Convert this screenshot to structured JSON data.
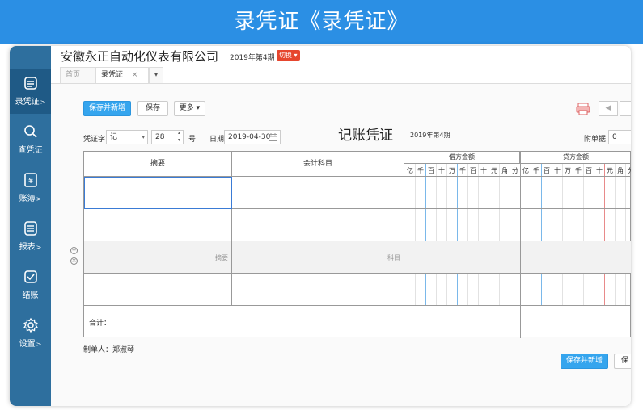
{
  "banner": {
    "title": "录凭证《录凭证》"
  },
  "sidebar": {
    "items": [
      {
        "label": "录凭证",
        "arrow": ">",
        "icon": "voucher-entry-icon",
        "active": true
      },
      {
        "label": "查凭证",
        "arrow": "",
        "icon": "search-icon",
        "active": false
      },
      {
        "label": "账簿",
        "arrow": ">",
        "icon": "ledger-yen-icon",
        "active": false
      },
      {
        "label": "报表",
        "arrow": ">",
        "icon": "report-icon",
        "active": false
      },
      {
        "label": "结账",
        "arrow": "",
        "icon": "checkout-icon",
        "active": false
      },
      {
        "label": "设置",
        "arrow": ">",
        "icon": "gear-icon",
        "active": false
      }
    ]
  },
  "header": {
    "company": "安徽永正自动化仪表有限公司",
    "period": "2019年第4期",
    "switch_label": "切换"
  },
  "tabs": [
    {
      "label": "首页",
      "active": false
    },
    {
      "label": "录凭证",
      "active": true,
      "close": "×"
    }
  ],
  "toolbar": {
    "save_new_label": "保存并新增",
    "save_label": "保存",
    "more_label": "更多"
  },
  "voucher": {
    "word_label": "凭证字",
    "word_value": "记",
    "number_value": "28",
    "number_suffix": "号",
    "date_label": "日期",
    "date_value": "2019-04-30",
    "title": "记账凭证",
    "period": "2019年第4期",
    "attachments_label": "附单据",
    "attachments_value": "0"
  },
  "table": {
    "col_summary": "摘要",
    "col_account": "会计科目",
    "col_debit": "借方金额",
    "col_credit": "贷方金额",
    "digits": [
      "亿",
      "千",
      "百",
      "十",
      "万",
      "千",
      "百",
      "十",
      "元",
      "角",
      "分"
    ],
    "placeholder_summary": "摘要",
    "placeholder_account": "科目",
    "total_label": "合计："
  },
  "footer": {
    "maker_label": "制单人：郑淑琴",
    "save_new_label": "保存并新增",
    "save_label_partial": "保"
  }
}
